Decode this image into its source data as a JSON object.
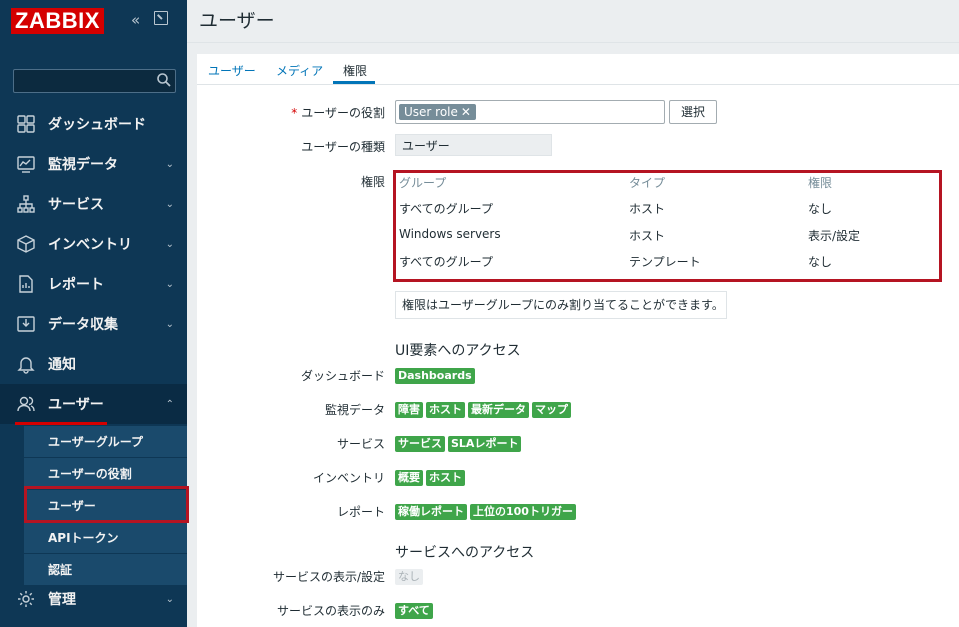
{
  "sidebar": {
    "logo": "ZABBIX",
    "collapse_icon": "«",
    "items": [
      {
        "label": "ダッシュボード",
        "icon": "dashboard-icon"
      },
      {
        "label": "監視データ",
        "icon": "monitoring-icon"
      },
      {
        "label": "サービス",
        "icon": "services-icon"
      },
      {
        "label": "インベントリ",
        "icon": "inventory-icon"
      },
      {
        "label": "レポート",
        "icon": "reports-icon"
      },
      {
        "label": "データ収集",
        "icon": "data-collection-icon"
      },
      {
        "label": "通知",
        "icon": "bell-icon"
      },
      {
        "label": "ユーザー",
        "icon": "users-icon"
      }
    ],
    "submenu": [
      "ユーザーグループ",
      "ユーザーの役割",
      "ユーザー",
      "APIトークン",
      "認証"
    ],
    "admin": "管理",
    "chevron_down": "⌄",
    "chevron_up": "⌃"
  },
  "page": {
    "title": "ユーザー",
    "tabs": [
      "ユーザー",
      "メディア",
      "権限"
    ],
    "active_tab": "権限"
  },
  "form": {
    "role_label": "ユーザーの役割",
    "role_required_mark": "*",
    "role_value": "User role",
    "role_remove": "✕",
    "select_button": "選択",
    "type_label": "ユーザーの種類",
    "type_value": "ユーザー",
    "perm_label": "権限",
    "perm_headers": [
      "グループ",
      "タイプ",
      "権限"
    ],
    "perm_rows": [
      [
        "すべてのグループ",
        "ホスト",
        "なし"
      ],
      [
        "Windows servers",
        "ホスト",
        "表示/設定"
      ],
      [
        "すべてのグループ",
        "テンプレート",
        "なし"
      ]
    ],
    "perm_note": "権限はユーザーグループにのみ割り当てることができます。",
    "ui_section": "UI要素へのアクセス",
    "ui_rows": [
      {
        "label": "ダッシュボード",
        "tags": [
          "Dashboards"
        ]
      },
      {
        "label": "監視データ",
        "tags": [
          "障害",
          "ホスト",
          "最新データ",
          "マップ"
        ]
      },
      {
        "label": "サービス",
        "tags": [
          "サービス",
          "SLAレポート"
        ]
      },
      {
        "label": "インベントリ",
        "tags": [
          "概要",
          "ホスト"
        ]
      },
      {
        "label": "レポート",
        "tags": [
          "稼働レポート",
          "上位の100トリガー"
        ]
      }
    ],
    "svc_section": "サービスへのアクセス",
    "svc_rows": [
      {
        "label": "サービスの表示/設定",
        "tags": [
          "なし"
        ],
        "disabled": true
      },
      {
        "label": "サービスの表示のみ",
        "tags": [
          "すべて"
        ],
        "disabled": false
      }
    ]
  },
  "colors": {
    "accent": "#0275b8",
    "brand": "#d40000",
    "tag": "#3fa54a",
    "highlight": "#b51422",
    "sidebar": "#0e3755"
  }
}
